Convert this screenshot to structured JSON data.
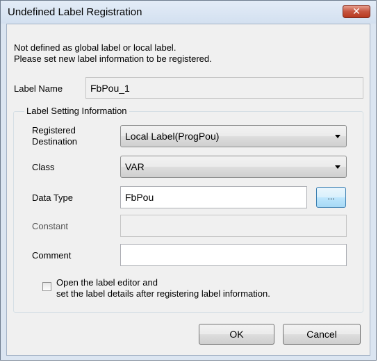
{
  "window": {
    "title": "Undefined Label Registration",
    "close_glyph": "✕"
  },
  "message": {
    "line1": "Not defined as global label or local label.",
    "line2": "Please set new label information to be registered."
  },
  "label_name": {
    "label": "Label Name",
    "value": "FbPou_1"
  },
  "label_setting": {
    "group_title": "Label Setting Information",
    "registered_destination": {
      "label_line1": "Registered",
      "label_line2": "Destination",
      "value": "Local Label(ProgPou)"
    },
    "class": {
      "label": "Class",
      "value": "VAR"
    },
    "data_type": {
      "label": "Data Type",
      "value": "FbPou",
      "browse_label": "..."
    },
    "constant": {
      "label": "Constant",
      "value": ""
    },
    "comment": {
      "label": "Comment",
      "value": ""
    },
    "open_editor": {
      "line1": "Open the label editor and",
      "line2": "set the label details after registering label information.",
      "checked": false
    }
  },
  "buttons": {
    "ok": "OK",
    "cancel": "Cancel"
  },
  "colors": {
    "frame": "#dbe5f1",
    "client": "#f0f0f0",
    "close_button": "#c6543f",
    "browse_button_border": "#3c7fb1"
  },
  "icons": {
    "close": "close-icon",
    "dropdown": "chevron-down-icon",
    "checkbox": "checkbox-unchecked-icon"
  }
}
